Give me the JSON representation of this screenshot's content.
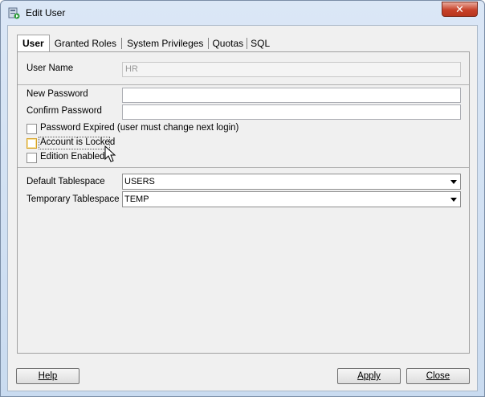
{
  "window": {
    "title": "Edit User",
    "close_glyph": "✕"
  },
  "tabs": [
    {
      "label": "User",
      "active": true
    },
    {
      "label": "Granted Roles",
      "active": false
    },
    {
      "label": "System Privileges",
      "active": false
    },
    {
      "label": "Quotas",
      "active": false
    },
    {
      "label": "SQL",
      "active": false
    }
  ],
  "form": {
    "user_name_label": "User Name",
    "user_name_value": "HR",
    "new_password_label": "New Password",
    "confirm_password_label": "Confirm Password",
    "password_expired_label": "Password Expired (user must change next login)",
    "account_locked_label": "Account is Locked",
    "edition_enabled_label": "Edition Enabled",
    "default_tablespace_label": "Default Tablespace",
    "default_tablespace_value": "USERS",
    "temporary_tablespace_label": "Temporary Tablespace",
    "temporary_tablespace_value": "TEMP"
  },
  "buttons": {
    "help": "Help",
    "apply": "Apply",
    "close": "Close"
  },
  "colors": {
    "close_button": "#c7422a",
    "focus_checkbox": "#d7a126"
  }
}
